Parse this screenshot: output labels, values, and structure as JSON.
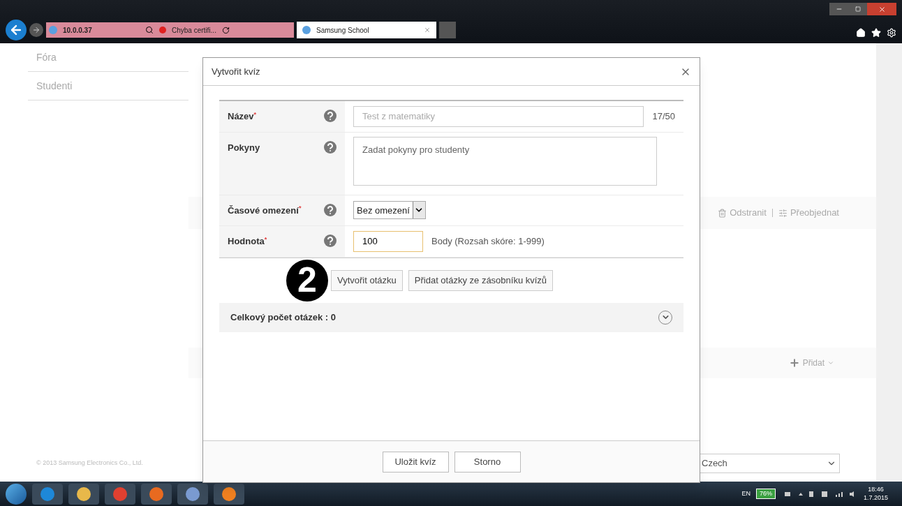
{
  "browser": {
    "url": "10.0.0.37",
    "cert_error": "Chyba certifi...",
    "tabs": [
      {
        "title": "Samsung School",
        "selected": true
      }
    ]
  },
  "sidebar": {
    "items": [
      {
        "label": "Fóra"
      },
      {
        "label": "Studenti"
      }
    ]
  },
  "background": {
    "toolbar": [
      "Odstranit",
      "Přeobjednat"
    ],
    "add_button": "Přidat",
    "footer": "© 2013 Samsung Electronics Co., Ltd.",
    "language": "Czech"
  },
  "dialog": {
    "title": "Vytvořit kvíz",
    "fields": [
      {
        "kind": "text",
        "label": "Název",
        "required_mark": "*",
        "placeholder": "Test z matematiky",
        "counter": "17/50"
      },
      {
        "kind": "textarea",
        "label": "Pokyny",
        "placeholder": "Zadat pokyny pro studenty"
      },
      {
        "kind": "select",
        "label": "Časové omezení",
        "required_mark": "*",
        "value": "Bez omezení"
      },
      {
        "kind": "number",
        "label": "Hodnota",
        "required_mark": "*",
        "value": "100",
        "focused": true,
        "suffix": "Body (Rozsah skóre: 1-999)"
      }
    ],
    "actions": [
      "Vytvořit otázku",
      "Přidat otázky ze zásobníku kvízů"
    ],
    "summary": {
      "label": "Celkový počet otázek : 0",
      "expanded": false
    },
    "buttons": [
      "Uložit kvíz",
      "Storno"
    ]
  },
  "callout": "2",
  "taskbar": {
    "language": "EN",
    "battery": "76%",
    "time": "18:46",
    "date": "1.7.2015"
  }
}
